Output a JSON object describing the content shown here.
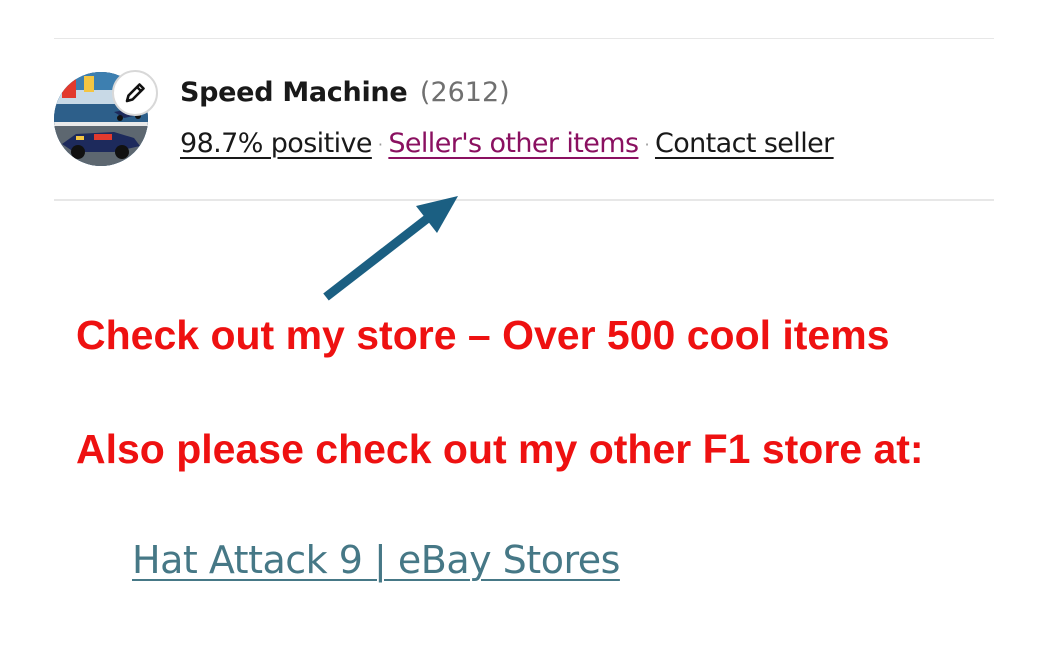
{
  "seller": {
    "name": "Speed Machine",
    "feedback_count": "(2612)",
    "positive_link": "98.7% positive",
    "separator": "·",
    "other_items_link": "Seller's other items",
    "contact_link": "Contact seller",
    "avatar_icon": "race-car-photo",
    "edit_icon": "pencil-icon"
  },
  "promo": {
    "line1": "Check out my store – Over 500 cool items",
    "line2": "Also please check out my other F1 store at:",
    "store_link": "Hat Attack 9 | eBay Stores"
  },
  "colors": {
    "promo_text": "#ee1111",
    "arrow": "#1b5f82",
    "other_items_link": "#8a1060",
    "store_link": "#467886"
  }
}
